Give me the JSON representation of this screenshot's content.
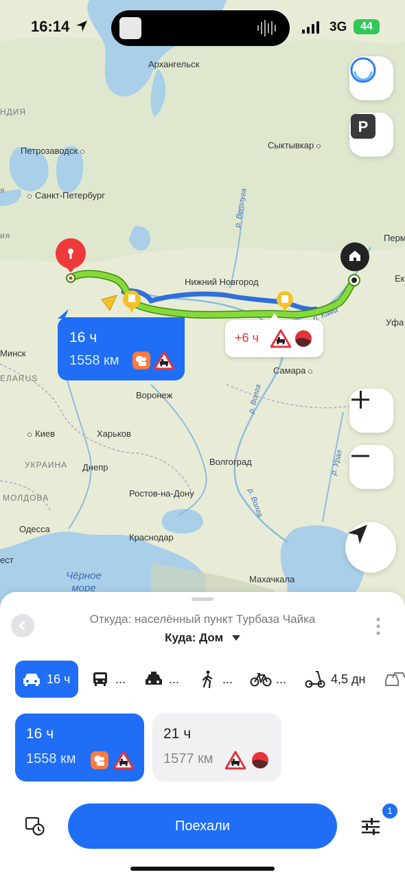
{
  "status_bar": {
    "time": "16:14",
    "network": "3G",
    "battery": "44"
  },
  "map": {
    "cities": [
      {
        "key": "arkh",
        "name": "Архангельск"
      },
      {
        "key": "petroz",
        "name": "Петрозаводск"
      },
      {
        "key": "syktyv",
        "name": "Сыктывкар"
      },
      {
        "key": "spb",
        "name": "Санкт-Петербург"
      },
      {
        "key": "perm",
        "name": "Перм"
      },
      {
        "key": "nnov",
        "name": "Нижний Новгород"
      },
      {
        "key": "ek",
        "name": "Ек"
      },
      {
        "key": "ufa",
        "name": "Уфа"
      },
      {
        "key": "minsk",
        "name": "Минск"
      },
      {
        "key": "samara",
        "name": "Самара"
      },
      {
        "key": "voronezh",
        "name": "Воронеж"
      },
      {
        "key": "kiev",
        "name": "Киев"
      },
      {
        "key": "kharkov",
        "name": "Харьков"
      },
      {
        "key": "dnepr",
        "name": "Днепр"
      },
      {
        "key": "volgograd",
        "name": "Волгоград"
      },
      {
        "key": "rostov",
        "name": "Ростов-на-Дону"
      },
      {
        "key": "odessa",
        "name": "Одесса"
      },
      {
        "key": "krasnodar",
        "name": "Краснодар"
      },
      {
        "key": "makhachkala",
        "name": "Махачкала"
      },
      {
        "key": "est",
        "name": "ест"
      }
    ],
    "regions": {
      "finland": "НДИЯ",
      "belarus": "ЕЛАRUS",
      "ukraine": "УКРАИНА",
      "moldova": "МОЛДОВА",
      "edge1": "ия",
      "edge2": "я"
    },
    "rivers": {
      "vetluga": "р. Ветлуга",
      "kama": "р. Кама",
      "volga1": "р. Волга",
      "volga2": "р. Волга",
      "ural": "р. Урал"
    },
    "sea": "Чёрное\nморе"
  },
  "route_bubble": {
    "duration": "16 ч",
    "distance": "1558 км"
  },
  "alt_bubble": {
    "delta": "+6 ч"
  },
  "sheet": {
    "from": "Откуда: населённый пункт Турбаза Чайка",
    "to": "Куда: Дом",
    "modes": {
      "car": "16 ч",
      "bus": "...",
      "taxi": "...",
      "walk": "...",
      "bike": "...",
      "scooter": "4,5 дн"
    },
    "routes": [
      {
        "duration": "16 ч",
        "distance": "1558 км"
      },
      {
        "duration": "21 ч",
        "distance": "1577 км"
      }
    ],
    "go_label": "Поехали",
    "settings_badge": "1"
  },
  "colors": {
    "accent": "#1f6ef5",
    "route_primary": "#7ed321",
    "route_alt": "#2f6fd8",
    "danger": "#e5333a"
  }
}
